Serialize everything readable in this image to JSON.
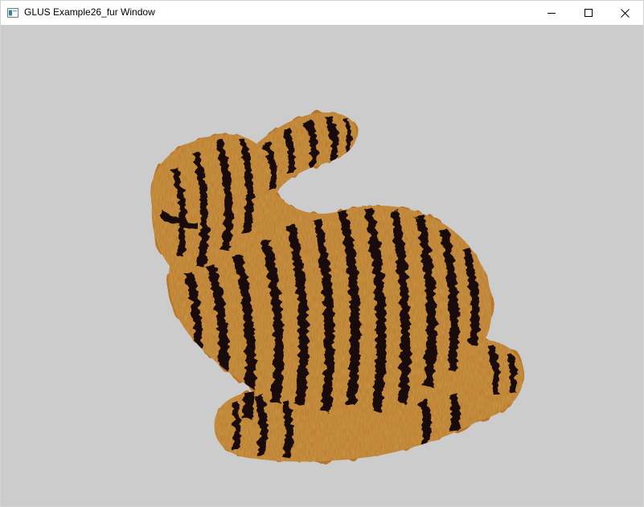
{
  "window": {
    "title": "GLUS Example26_fur Window",
    "icon": "app-window-icon",
    "controls": {
      "minimize": "minimize-icon",
      "maximize": "maximize-icon",
      "close": "close-icon"
    }
  },
  "viewport": {
    "background_color": "#cccccc",
    "content": "fur-rendered bunny with tiger stripe texture"
  },
  "colors": {
    "fur_base": "#c9832c",
    "fur_light": "#e0a44f",
    "fur_dark": "#8a5219",
    "stripe": "#1c1007",
    "titlebar": "#ffffff"
  }
}
